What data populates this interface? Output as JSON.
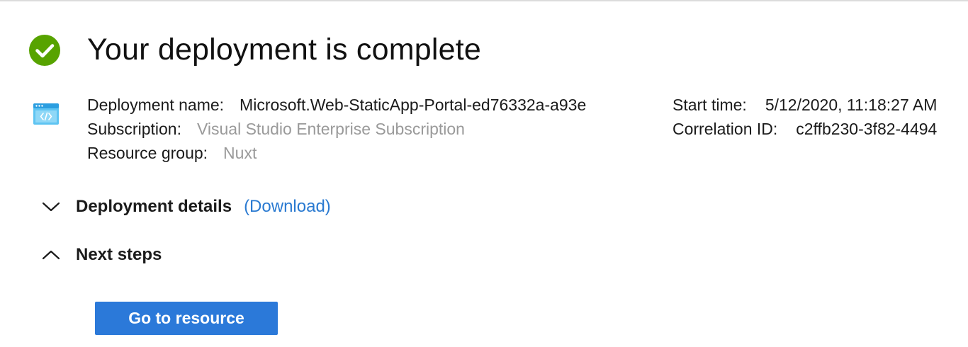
{
  "header": {
    "title": "Your deployment is complete",
    "status_icon": "success-check-icon",
    "status_color": "#57a300"
  },
  "deployment": {
    "icon": "static-web-app-icon",
    "name_label": "Deployment name:",
    "name_value": "Microsoft.Web-StaticApp-Portal-ed76332a-a93e",
    "subscription_label": "Subscription:",
    "subscription_value": "Visual Studio Enterprise Subscription",
    "resource_group_label": "Resource group:",
    "resource_group_value": "Nuxt",
    "start_time_label": "Start time:",
    "start_time_value": "5/12/2020, 11:18:27 AM",
    "correlation_label": "Correlation ID:",
    "correlation_value": "c2ffb230-3f82-4494"
  },
  "sections": {
    "details_title": "Deployment details",
    "details_link": "(Download)",
    "details_icon": "chevron-down-icon",
    "next_title": "Next steps",
    "next_icon": "chevron-up-icon"
  },
  "actions": {
    "go_to_resource": "Go to resource",
    "button_color": "#2b79d9",
    "link_color": "#2a7ad1"
  }
}
